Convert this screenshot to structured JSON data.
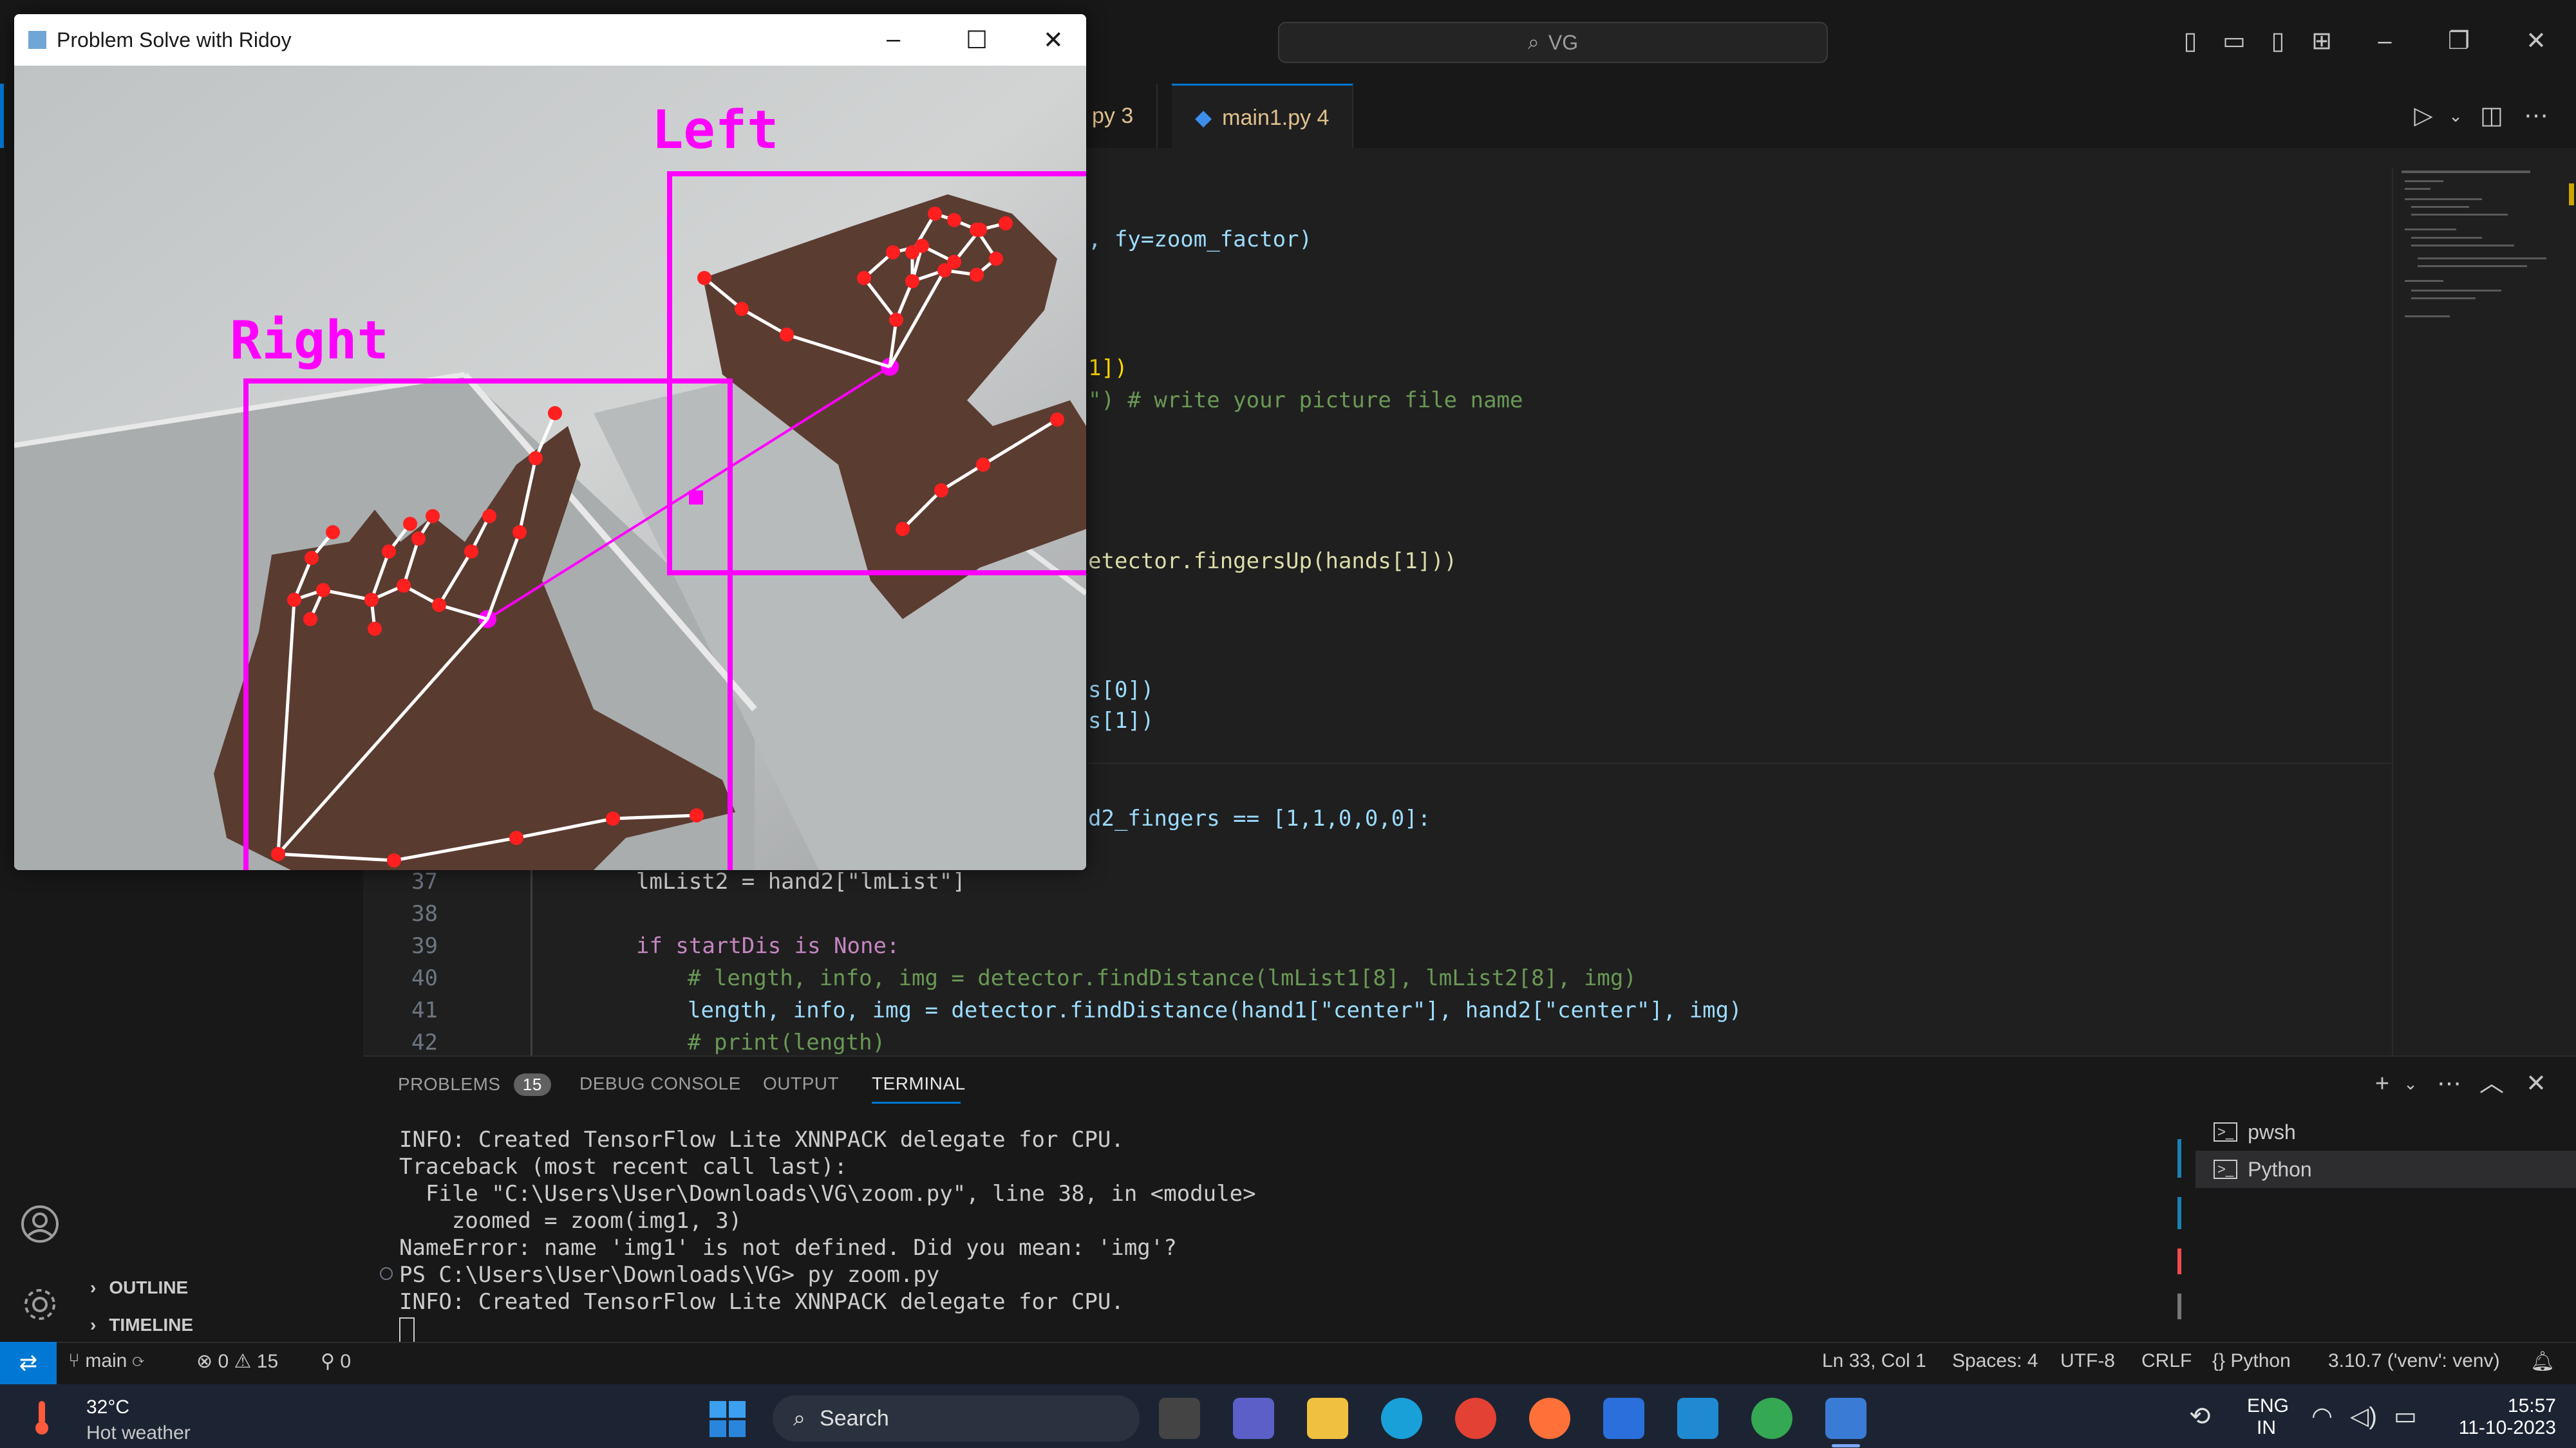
{
  "titlebar": {
    "search_text": "VG"
  },
  "tabs": [
    {
      "label": "py 3"
    },
    {
      "label": "main1.py 4"
    }
  ],
  "code_partial": [
    {
      "text": ", fy=zoom_factor)"
    },
    {
      "text": "1])"
    },
    {
      "text": "\") # write your picture file name"
    },
    {
      "text": "etector.fingersUp(hands[1]))"
    },
    {
      "text": "s[0])"
    },
    {
      "text": "s[1])"
    },
    {
      "text": "d2_fingers == [1,1,0,0,0]:"
    }
  ],
  "code_lines": [
    {
      "num": "37",
      "text": "lmList2 = hand2[\"lmList\"]"
    },
    {
      "num": "38",
      "text": ""
    },
    {
      "num": "39",
      "text": "if startDis is None:"
    },
    {
      "num": "40",
      "text": "# length, info, img = detector.findDistance(lmList1[8], lmList2[8], img)"
    },
    {
      "num": "41",
      "text": "length, info, img = detector.findDistance(hand1[\"center\"], hand2[\"center\"], img)"
    },
    {
      "num": "42",
      "text": "# print(length)"
    }
  ],
  "panel": {
    "tabs": {
      "problems": "PROBLEMS",
      "problems_count": "15",
      "debug": "DEBUG CONSOLE",
      "output": "OUTPUT",
      "terminal": "TERMINAL"
    },
    "terminal_lines": [
      "INFO: Created TensorFlow Lite XNNPACK delegate for CPU.",
      "Traceback (most recent call last):",
      "  File \"C:\\Users\\User\\Downloads\\VG\\zoom.py\", line 38, in <module>",
      "    zoomed = zoom(img1, 3)",
      "NameError: name 'img1' is not defined. Did you mean: 'img'?",
      "PS C:\\Users\\User\\Downloads\\VG> py zoom.py",
      "INFO: Created TensorFlow Lite XNNPACK delegate for CPU."
    ],
    "terminals": [
      {
        "label": "pwsh"
      },
      {
        "label": "Python"
      }
    ]
  },
  "sidebar": {
    "outline": "OUTLINE",
    "timeline": "TIMELINE"
  },
  "statusbar": {
    "branch": "main",
    "errors": "0",
    "warnings": "15",
    "ports": "0",
    "position": "Ln 33, Col 1",
    "spaces": "Spaces: 4",
    "encoding": "UTF-8",
    "eol": "CRLF",
    "language": "Python",
    "interpreter": "3.10.7 ('venv': venv)"
  },
  "python_window": {
    "title": "Problem Solve with Ridoy",
    "label_left": "Left",
    "label_right": "Right"
  },
  "taskbar": {
    "temperature": "32°C",
    "weather": "Hot weather",
    "search_label": "Search",
    "lang_line1": "ENG",
    "lang_line2": "IN",
    "time": "15:57",
    "date": "11-10-2023"
  },
  "colors": {
    "accent_blue": "#0078d4",
    "magenta": "#ff00ff",
    "editor_bg": "#1f1f1f"
  }
}
